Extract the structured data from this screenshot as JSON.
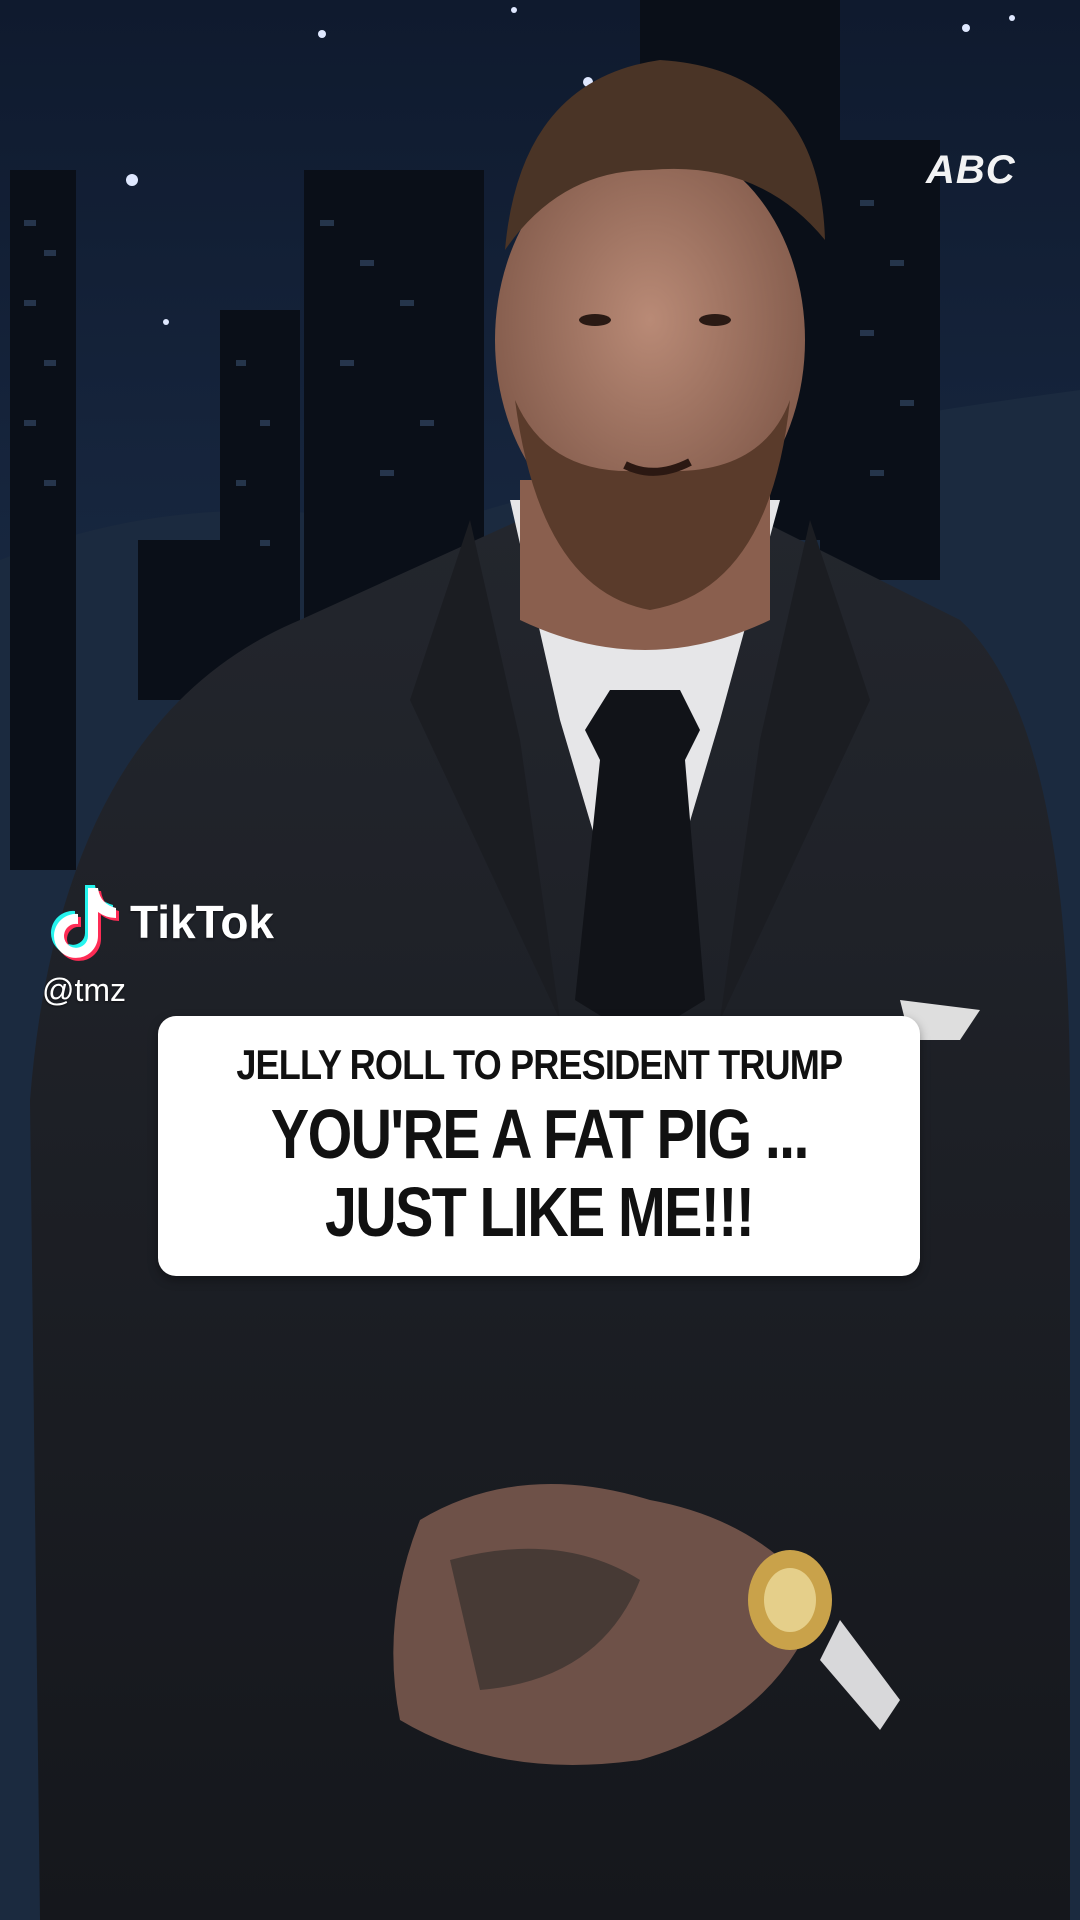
{
  "video": {
    "network_watermark": "ABC",
    "subject": "man-in-suit-speaking"
  },
  "overlay": {
    "platform_logo": {
      "icon": "tiktok-note-icon",
      "wordmark": "TikTok"
    },
    "handle": "@tmz"
  },
  "caption": {
    "line1": "JELLY ROLL TO PRESIDENT TRUMP",
    "line2": "YOU'RE A FAT PIG ...",
    "line3": "JUST LIKE ME!!!"
  },
  "colors": {
    "background": "#0d1220",
    "caption_bg": "#ffffff",
    "caption_text": "#111111",
    "tiktok_cyan": "#25F4EE",
    "tiktok_red": "#FE2C55"
  }
}
